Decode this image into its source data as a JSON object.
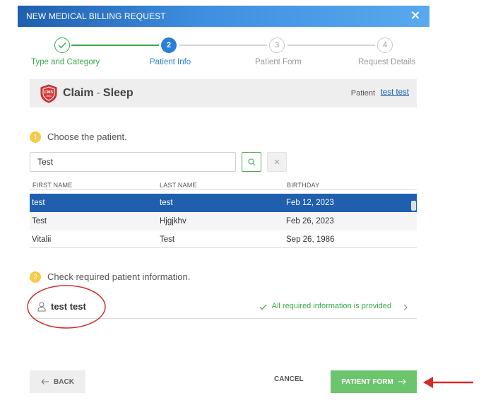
{
  "modal": {
    "title": "NEW MEDICAL BILLING REQUEST"
  },
  "stepper": {
    "steps": [
      {
        "number": "",
        "label": "Type and Category",
        "state": "done"
      },
      {
        "number": "2",
        "label": "Patient Info",
        "state": "active"
      },
      {
        "number": "3",
        "label": "Patient Form",
        "state": "future"
      },
      {
        "number": "4",
        "label": "Request Details",
        "state": "future"
      }
    ]
  },
  "claim": {
    "badge_text": "CMS",
    "badge_sub": "1500",
    "title": "Claim",
    "separator": "-",
    "subtitle": "Sleep",
    "patient_label": "Patient",
    "patient_name": "test test"
  },
  "section1": {
    "number": "1",
    "title": "Choose the patient."
  },
  "search": {
    "value": "Test",
    "search_icon": "search-icon",
    "clear_icon": "close-icon"
  },
  "table": {
    "headers": [
      "FIRST NAME",
      "LAST NAME",
      "BIRTHDAY"
    ],
    "rows": [
      {
        "first": "test",
        "last": "test",
        "birthday": "Feb 12, 2023",
        "selected": true
      },
      {
        "first": "Test",
        "last": "Hjgjkhv",
        "birthday": "Feb 26, 2023",
        "selected": false
      },
      {
        "first": "Vitalii",
        "last": "Test",
        "birthday": "Sep 26, 1986",
        "selected": false
      }
    ]
  },
  "section2": {
    "number": "2",
    "title": "Check required patient information."
  },
  "required": {
    "patient_name": "test test",
    "status": "All required information is provided",
    "status_color": "#3aa84a"
  },
  "footer": {
    "back_label": "BACK",
    "cancel_label": "CANCEL",
    "next_label": "PATIENT FORM"
  },
  "colors": {
    "primary": "#1f5fae",
    "success": "#3aa84a",
    "next_button": "#6cc46d",
    "step_badge": "#f7c948",
    "annotation": "#d32a2a"
  }
}
